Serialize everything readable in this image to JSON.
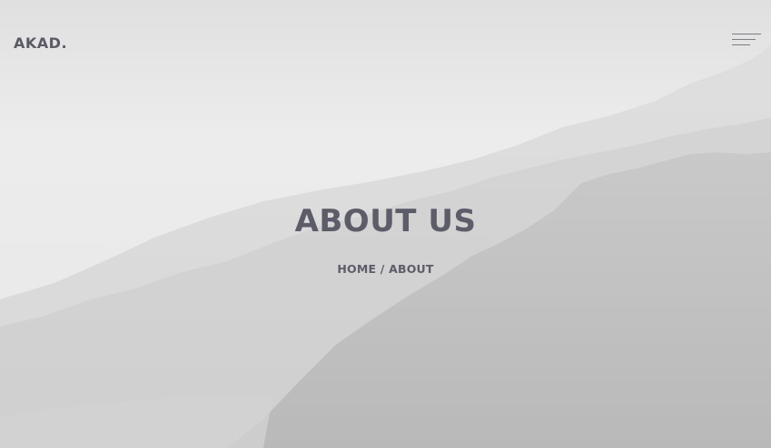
{
  "header": {
    "logo_text": "AKAD.",
    "menu_icon": "hamburger-menu-icon"
  },
  "hero": {
    "title": "ABOUT US",
    "breadcrumb": {
      "home_label": "HOME",
      "separator": "/",
      "current_label": "ABOUT"
    }
  },
  "colors": {
    "text": "#5c5d69",
    "background": "#e4e4e4"
  }
}
